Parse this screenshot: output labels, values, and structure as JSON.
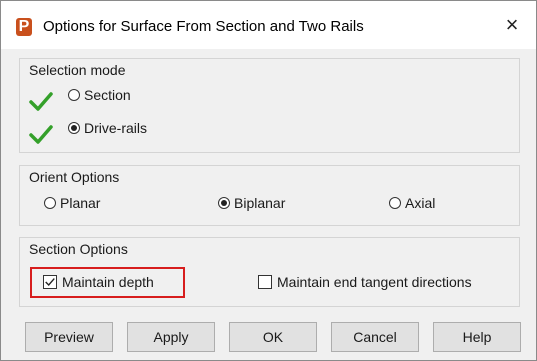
{
  "window": {
    "title": "Options for Surface From Section and Two Rails",
    "app_icon_letter": "P",
    "close_glyph": "×",
    "accent_color": "#c9501d"
  },
  "selection_mode": {
    "label": "Selection mode",
    "options": [
      {
        "label": "Section",
        "selected": false,
        "status_icon": "green-check-icon"
      },
      {
        "label": "Drive-rails",
        "selected": true,
        "status_icon": "green-check-icon"
      }
    ]
  },
  "orient_options": {
    "label": "Orient Options",
    "options": [
      {
        "label": "Planar",
        "selected": false
      },
      {
        "label": "Biplanar",
        "selected": true
      },
      {
        "label": "Axial",
        "selected": false
      }
    ]
  },
  "section_options": {
    "label": "Section Options",
    "maintain_depth": {
      "label": "Maintain depth",
      "checked": true,
      "highlight_color": "#d71d1d"
    },
    "maintain_tangent": {
      "label": "Maintain end tangent directions",
      "checked": false
    }
  },
  "buttons": {
    "preview": "Preview",
    "apply": "Apply",
    "ok": "OK",
    "cancel": "Cancel",
    "help": "Help"
  }
}
